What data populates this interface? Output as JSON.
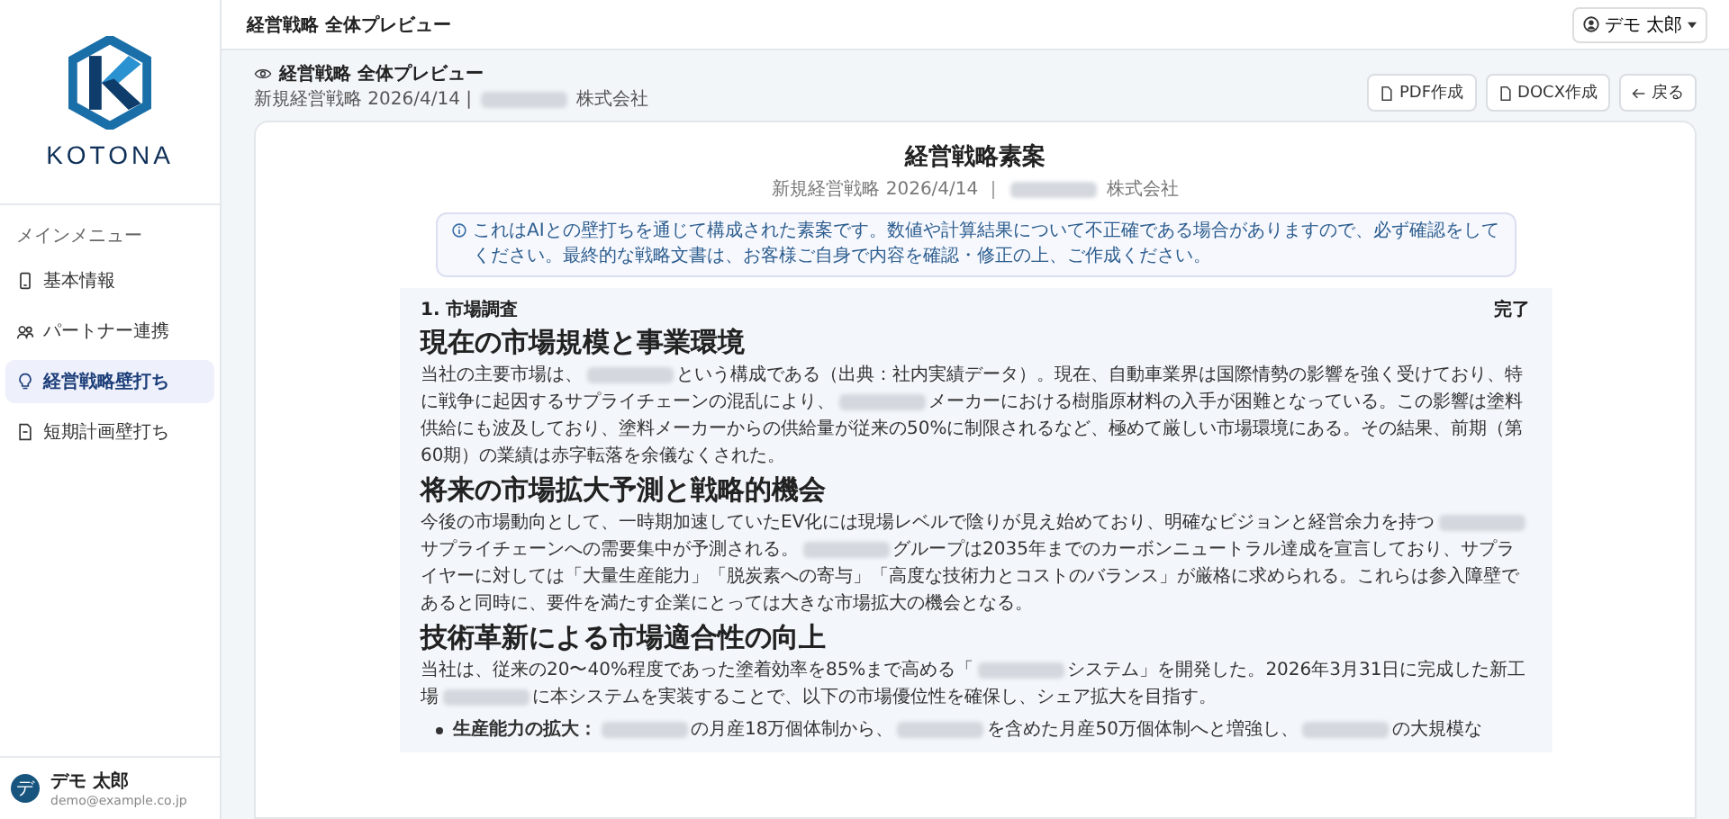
{
  "sidebar": {
    "brand": "KOTONA",
    "menu_label": "メインメニュー",
    "items": [
      {
        "label": "基本情報",
        "kind": "info",
        "selected": false
      },
      {
        "label": "パートナー連携",
        "kind": "partner",
        "selected": false
      },
      {
        "label": "経営戦略壁打ち",
        "kind": "idea",
        "selected": true
      },
      {
        "label": "短期計画壁打ち",
        "kind": "doc",
        "selected": false
      }
    ],
    "user": {
      "initial": "デ",
      "name": "デモ 太郎",
      "email": "demo@example.co.jp"
    }
  },
  "header": {
    "title": "経営戦略 全体プレビュー",
    "user_menu": "デモ 太郎"
  },
  "page": {
    "title": "経営戦略 全体プレビュー",
    "subtitle": [
      {
        "kind": "text",
        "text": "新規経営戦略 2026/4/14 |"
      },
      {
        "kind": "redacted"
      },
      {
        "kind": "text",
        "text": "株式会社"
      }
    ],
    "buttons": [
      {
        "label": "PDF作成",
        "kind": "file"
      },
      {
        "label": "DOCX作成",
        "kind": "file"
      },
      {
        "label": "戻る",
        "kind": "back"
      }
    ]
  },
  "document": {
    "title": "経営戦略素案",
    "subtitle": [
      {
        "kind": "text",
        "text": "新規経営戦略 2026/4/14 ｜"
      },
      {
        "kind": "redacted"
      },
      {
        "kind": "text",
        "text": "株式会社"
      }
    ],
    "notice": "これはAIとの壁打ちを通じて構成された素案です。数値や計算結果について不正確である場合がありますので、必ず確認をしてください。最終的な戦略文書は、お客様ご自身で内容を確認・修正の上、ご作成ください。",
    "section": {
      "label": "1. 市場調査",
      "status": "完了",
      "blocks": [
        {
          "kind": "heading",
          "text": "現在の市場規模と事業環境"
        },
        {
          "kind": "paragraph",
          "segments": [
            {
              "kind": "text",
              "text": "当社の主要市場は、"
            },
            {
              "kind": "redacted"
            },
            {
              "kind": "text",
              "text": "という構成である（出典：社内実績データ）。現在、自動車業界は国際情勢の影響を強く受けており、特に戦争に起因するサプライチェーンの混乱により、"
            },
            {
              "kind": "redacted"
            },
            {
              "kind": "text",
              "text": "メーカーにおける樹脂原材料の入手が困難となっている。この影響は塗料供給にも波及しており、塗料メーカーからの供給量が従来の50%に制限されるなど、極めて厳しい市場環境にある。その結果、前期（第60期）の業績は赤字転落を余儀なくされた。"
            }
          ]
        },
        {
          "kind": "heading",
          "text": "将来の市場拡大予測と戦略的機会"
        },
        {
          "kind": "paragraph",
          "segments": [
            {
              "kind": "text",
              "text": "今後の市場動向として、一時期加速していたEV化には現場レベルで陰りが見え始めており、明確なビジョンと経営余力を持つ"
            },
            {
              "kind": "redacted"
            },
            {
              "kind": "text",
              "text": "サプライチェーンへの需要集中が予測される。"
            },
            {
              "kind": "redacted"
            },
            {
              "kind": "text",
              "text": "グループは2035年までのカーボンニュートラル達成を宣言しており、サプライヤーに対しては「大量生産能力」「脱炭素への寄与」「高度な技術力とコストのバランス」が厳格に求められる。これらは参入障壁であると同時に、要件を満たす企業にとっては大きな市場拡大の機会となる。"
            }
          ]
        },
        {
          "kind": "heading",
          "text": "技術革新による市場適合性の向上"
        },
        {
          "kind": "paragraph",
          "segments": [
            {
              "kind": "text",
              "text": "当社は、従来の20〜40%程度であった塗着効率を85%まで高める「"
            },
            {
              "kind": "redacted"
            },
            {
              "kind": "text",
              "text": "システム」を開発した。2026年3月31日に完成した新工場"
            },
            {
              "kind": "redacted"
            },
            {
              "kind": "text",
              "text": "に本システムを実装することで、以下の市場優位性を確保し、シェア拡大を目指す。"
            }
          ]
        },
        {
          "kind": "bullet",
          "segments": [
            {
              "kind": "bold",
              "text": "生産能力の拡大："
            },
            {
              "kind": "redacted"
            },
            {
              "kind": "text",
              "text": "の月産18万個体制から、"
            },
            {
              "kind": "redacted"
            },
            {
              "kind": "text",
              "text": "を含めた月産50万個体制へと増強し、"
            },
            {
              "kind": "redacted"
            },
            {
              "kind": "text",
              "text": "の大規模な"
            }
          ]
        }
      ]
    }
  }
}
